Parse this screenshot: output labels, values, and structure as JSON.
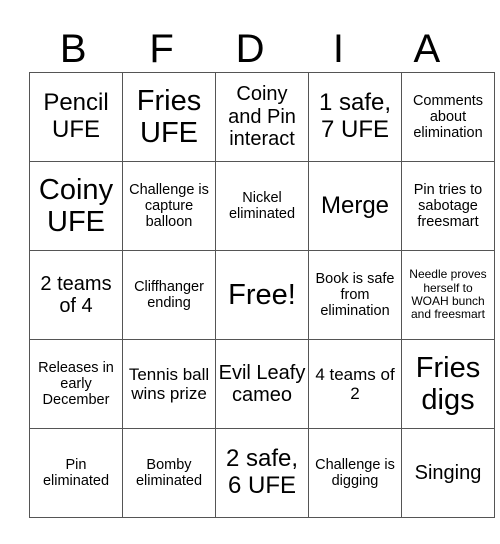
{
  "card": {
    "header_letters": [
      "B",
      "F",
      "D",
      "I",
      "A"
    ],
    "rows": [
      [
        {
          "text": "Pencil UFE",
          "size": "l"
        },
        {
          "text": "Fries UFE",
          "size": "xl"
        },
        {
          "text": "Coiny and Pin interact",
          "size": "ml"
        },
        {
          "text": "1 safe, 7 UFE",
          "size": "l"
        },
        {
          "text": "Comments about elimination",
          "size": "s"
        }
      ],
      [
        {
          "text": "Coiny UFE",
          "size": "xl"
        },
        {
          "text": "Challenge is capture balloon",
          "size": "s"
        },
        {
          "text": "Nickel eliminated",
          "size": "s"
        },
        {
          "text": "Merge",
          "size": "l"
        },
        {
          "text": "Pin tries to sabotage freesmart",
          "size": "s"
        }
      ],
      [
        {
          "text": "2 teams of 4",
          "size": "ml"
        },
        {
          "text": "Cliffhanger ending",
          "size": "s"
        },
        {
          "text": "Free!",
          "size": "xl",
          "free": true
        },
        {
          "text": "Book is safe from elimination",
          "size": "s"
        },
        {
          "text": "Needle proves herself to WOAH bunch and freesmart",
          "size": "xs"
        }
      ],
      [
        {
          "text": "Releases in early December",
          "size": "s"
        },
        {
          "text": "Tennis ball wins prize",
          "size": "m"
        },
        {
          "text": "Evil Leafy cameo",
          "size": "ml"
        },
        {
          "text": "4 teams of 2",
          "size": "m"
        },
        {
          "text": "Fries digs",
          "size": "xl"
        }
      ],
      [
        {
          "text": "Pin eliminated",
          "size": "s"
        },
        {
          "text": "Bomby eliminated",
          "size": "s"
        },
        {
          "text": "2 safe, 6 UFE",
          "size": "l"
        },
        {
          "text": "Challenge is digging",
          "size": "s"
        },
        {
          "text": "Singing",
          "size": "ml"
        }
      ]
    ]
  }
}
